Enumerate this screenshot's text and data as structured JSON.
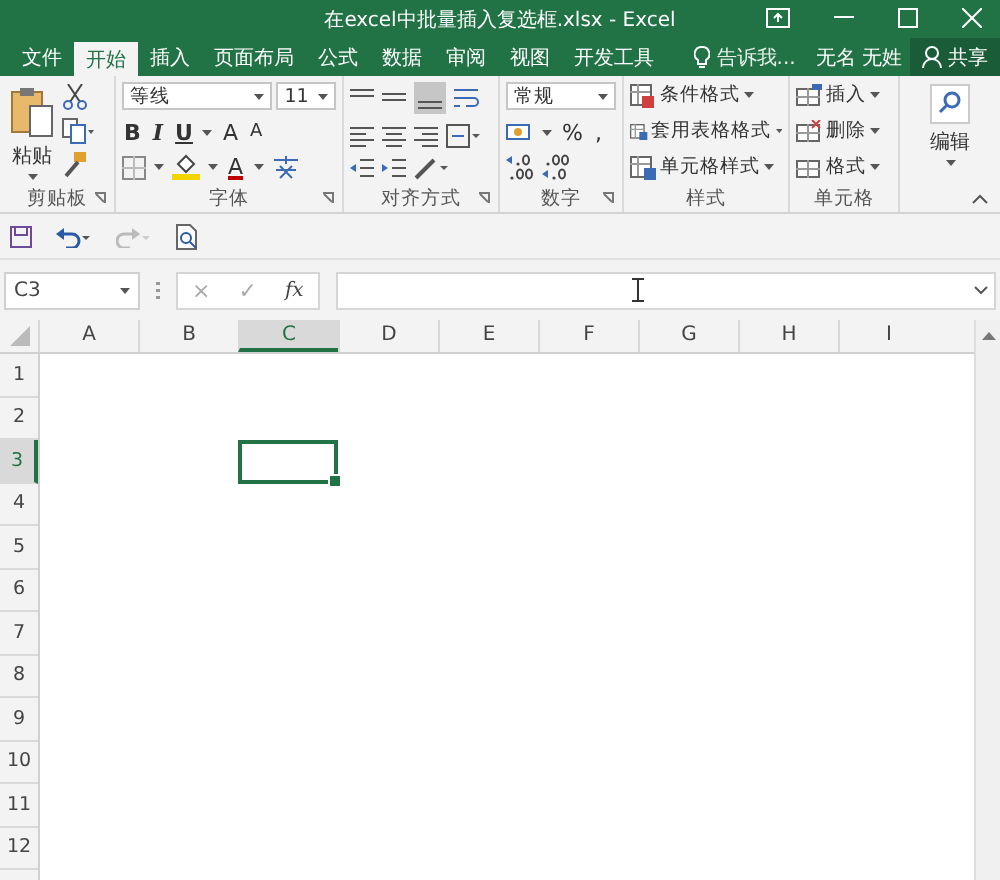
{
  "window": {
    "title": "在excel中批量插入复选框.xlsx - Excel"
  },
  "tabs": [
    {
      "label": "文件",
      "selected": false
    },
    {
      "label": "开始",
      "selected": true
    },
    {
      "label": "插入",
      "selected": false
    },
    {
      "label": "页面布局",
      "selected": false
    },
    {
      "label": "公式",
      "selected": false
    },
    {
      "label": "数据",
      "selected": false
    },
    {
      "label": "审阅",
      "selected": false
    },
    {
      "label": "视图",
      "selected": false
    },
    {
      "label": "开发工具",
      "selected": false
    }
  ],
  "tell_me": "告诉我...",
  "user": "无名 无姓",
  "share_button": "共享",
  "ribbon": {
    "clipboard": {
      "label": "剪贴板",
      "paste": "粘贴"
    },
    "font": {
      "label": "字体",
      "font_name": "等线",
      "font_size": "11",
      "style_buttons": [
        "B",
        "I",
        "U"
      ],
      "size_buttons": [
        "A",
        "A"
      ],
      "color_button": "A"
    },
    "alignment": {
      "label": "对齐方式"
    },
    "number": {
      "label": "数字",
      "format": "常规",
      "symbols": [
        "%",
        ","
      ]
    },
    "styles": {
      "label": "样式",
      "buttons": [
        "条件格式",
        "套用表格格式",
        "单元格样式"
      ]
    },
    "cells": {
      "label": "单元格",
      "buttons": [
        "插入",
        "删除",
        "格式"
      ]
    },
    "editing": {
      "label": "编辑"
    }
  },
  "name_box": {
    "value": "C3"
  },
  "formula_buttons": [
    "×",
    "✓",
    "fx"
  ],
  "columns": [
    {
      "label": "A",
      "selected": false
    },
    {
      "label": "B",
      "selected": false
    },
    {
      "label": "C",
      "selected": true
    },
    {
      "label": "D",
      "selected": false
    },
    {
      "label": "E",
      "selected": false
    },
    {
      "label": "F",
      "selected": false
    },
    {
      "label": "G",
      "selected": false
    },
    {
      "label": "H",
      "selected": false
    },
    {
      "label": "I",
      "selected": false
    }
  ],
  "rows": [
    {
      "label": "1",
      "selected": false
    },
    {
      "label": "2",
      "selected": false
    },
    {
      "label": "3",
      "selected": true
    },
    {
      "label": "4",
      "selected": false
    },
    {
      "label": "5",
      "selected": false
    },
    {
      "label": "6",
      "selected": false
    },
    {
      "label": "7",
      "selected": false
    },
    {
      "label": "8",
      "selected": false
    },
    {
      "label": "9",
      "selected": false
    },
    {
      "label": "10",
      "selected": false
    },
    {
      "label": "11",
      "selected": false
    },
    {
      "label": "12",
      "selected": false
    }
  ]
}
